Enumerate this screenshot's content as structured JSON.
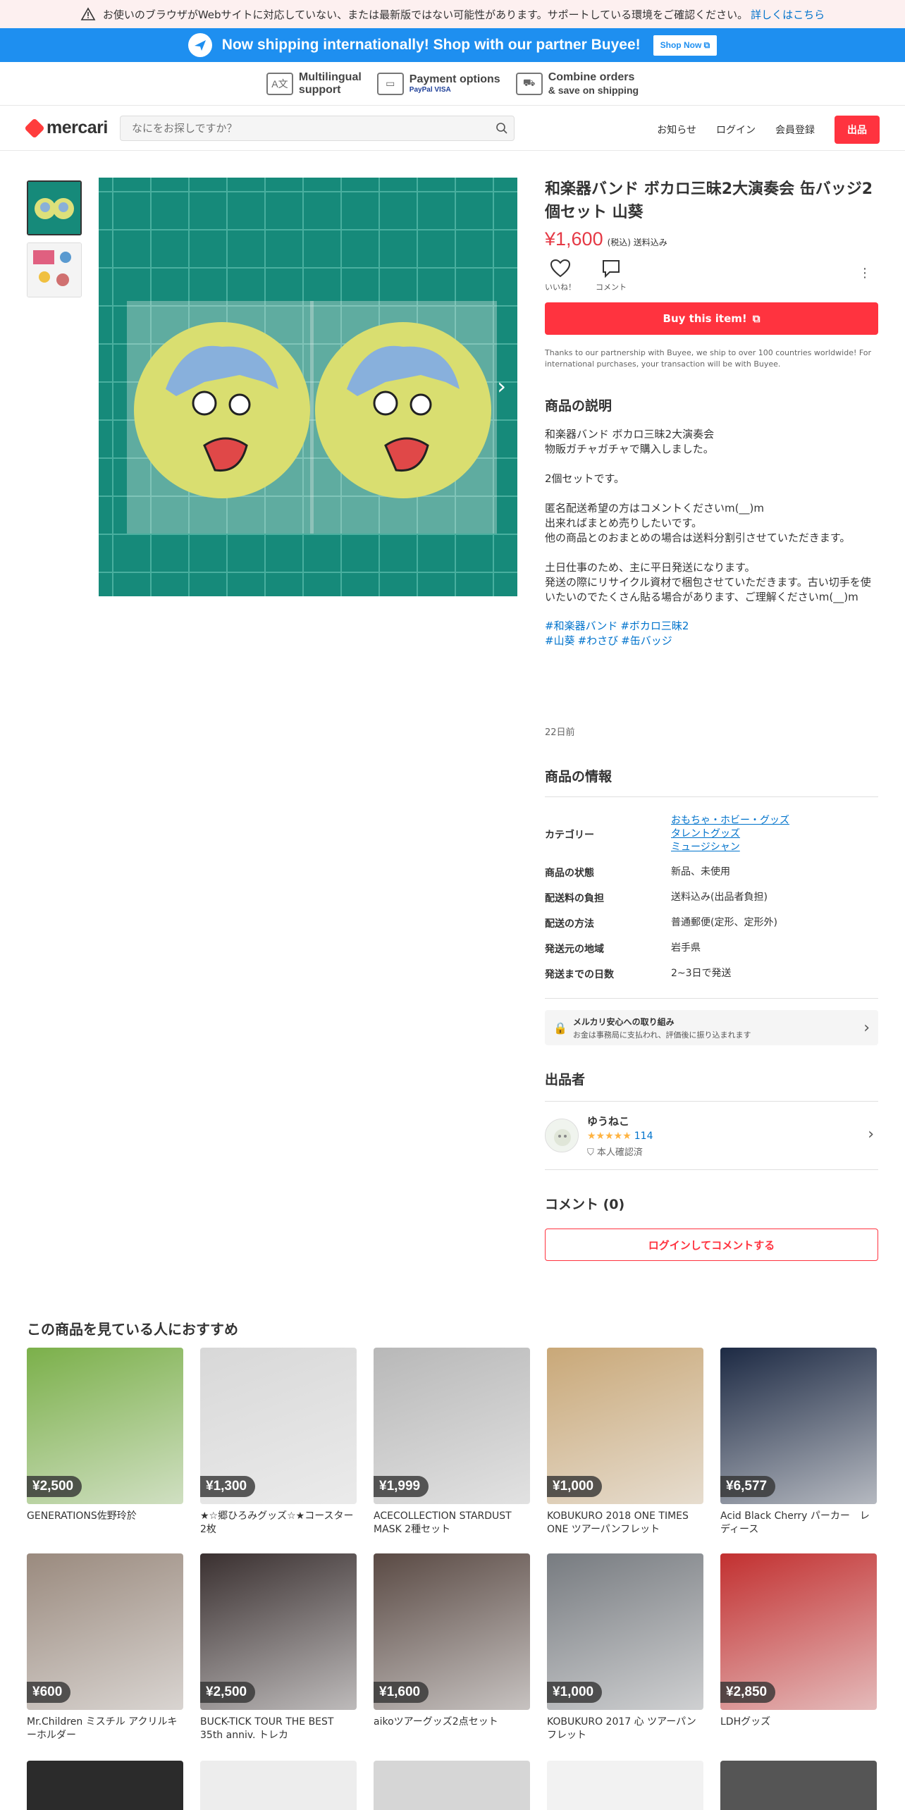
{
  "warning": {
    "text": "お使いのブラウザがWebサイトに対応していない、または最新版ではない可能性があります。サポートしている環境をご確認ください。",
    "link": "詳しくはこちら"
  },
  "buyee": {
    "message": "Now shipping internationally! Shop with our partner Buyee!",
    "button": "Shop Now"
  },
  "features": [
    {
      "title": "Multilingual",
      "sub": "support",
      "icon": "translate-icon"
    },
    {
      "title": "Payment options",
      "sub": "PayPal VISA",
      "icon": "card-icon"
    },
    {
      "title": "Combine orders",
      "sub": "& save on shipping",
      "icon": "truck-icon"
    }
  ],
  "header": {
    "logo": "mercari",
    "search_placeholder": "なにをお探しですか？",
    "nav": [
      "お知らせ",
      "ログイン",
      "会員登録"
    ],
    "sell": "出品"
  },
  "product": {
    "title": "和楽器バンド ボカロ三昧2大演奏会 缶バッジ2個セット 山葵",
    "price": "¥1,600",
    "tax": "(税込) 送料込み",
    "like_label": "いいね！",
    "comment_label": "コメント",
    "buy_button": "Buy this item!",
    "partner_note": "Thanks to our partnership with Buyee, we ship to over 100 countries worldwide! For international purchases, your transaction will be with Buyee.",
    "description_heading": "商品の説明",
    "description": "和楽器バンド ボカロ三昧2大演奏会\n物販ガチャガチャで購入しました。\n\n2個セットです。\n\n匿名配送希望の方はコメントくださいm(__)m\n出来ればまとめ売りしたいです。\n他の商品とのおまとめの場合は送料分割引させていただきます。\n\n土日仕事のため、主に平日発送になります。\n発送の際にリサイクル資材で梱包させていただきます。古い切手を使いたいのでたくさん貼る場合があります、ご理解くださいm(__)m",
    "tags_line1": [
      "#和楽器バンド",
      "#ボカロ三昧2"
    ],
    "tags_line2": [
      "#山葵",
      "#わさび",
      "#缶バッジ"
    ],
    "posted": "22日前"
  },
  "info": {
    "heading": "商品の情報",
    "category_label": "カテゴリー",
    "categories": [
      "おもちゃ・ホビー・グッズ",
      "タレントグッズ",
      "ミュージシャン"
    ],
    "rows": [
      {
        "k": "商品の状態",
        "v": "新品、未使用"
      },
      {
        "k": "配送料の負担",
        "v": "送料込み(出品者負担)"
      },
      {
        "k": "配送の方法",
        "v": "普通郵便(定形、定形外)"
      },
      {
        "k": "発送元の地域",
        "v": "岩手県"
      },
      {
        "k": "発送までの日数",
        "v": "2~3日で発送"
      }
    ]
  },
  "safety": {
    "title": "メルカリ安心への取り組み",
    "body": "お金は事務局に支払われ、評価後に振り込まれます"
  },
  "seller": {
    "heading": "出品者",
    "name": "ゆうねこ",
    "stars": "★★★★★",
    "count": "114",
    "verified": "本人確認済"
  },
  "comments": {
    "heading": "コメント (0)",
    "button": "ログインしてコメントする"
  },
  "recommend": {
    "heading": "この商品を見ている人におすすめ",
    "items": [
      {
        "price": "¥2,500",
        "name": "GENERATIONS佐野玲於",
        "color": "#7bb04a"
      },
      {
        "price": "¥1,300",
        "name": "★☆郷ひろみグッズ☆★コースター2枚",
        "color": "#d8d8d8"
      },
      {
        "price": "¥1,999",
        "name": "ACECOLLECTION STARDUST MASK 2種セット",
        "color": "#b8b8b8"
      },
      {
        "price": "¥1,000",
        "name": "KOBUKURO 2018 ONE TIMES ONE ツアーパンフレット",
        "color": "#c9a878"
      },
      {
        "price": "¥6,577",
        "name": "Acid Black Cherry パーカー　レディース",
        "color": "#1d2a44"
      },
      {
        "price": "¥600",
        "name": "Mr.Children ミスチル アクリルキーホルダー",
        "color": "#9a8a7e"
      },
      {
        "price": "¥2,500",
        "name": "BUCK-TICK TOUR THE BEST 35th anniv. トレカ",
        "color": "#3a3030"
      },
      {
        "price": "¥1,600",
        "name": "aikoツアーグッズ2点セット",
        "color": "#5a4a44"
      },
      {
        "price": "¥1,000",
        "name": "KOBUKURO 2017 心 ツアーパンフレット",
        "color": "#777b80"
      },
      {
        "price": "¥2,850",
        "name": "LDHグッズ",
        "color": "#c23030"
      }
    ],
    "row3_colors": [
      "#2b2b2b",
      "#ededed",
      "#d6d6d6",
      "#f2f2f2",
      "#555555"
    ]
  }
}
